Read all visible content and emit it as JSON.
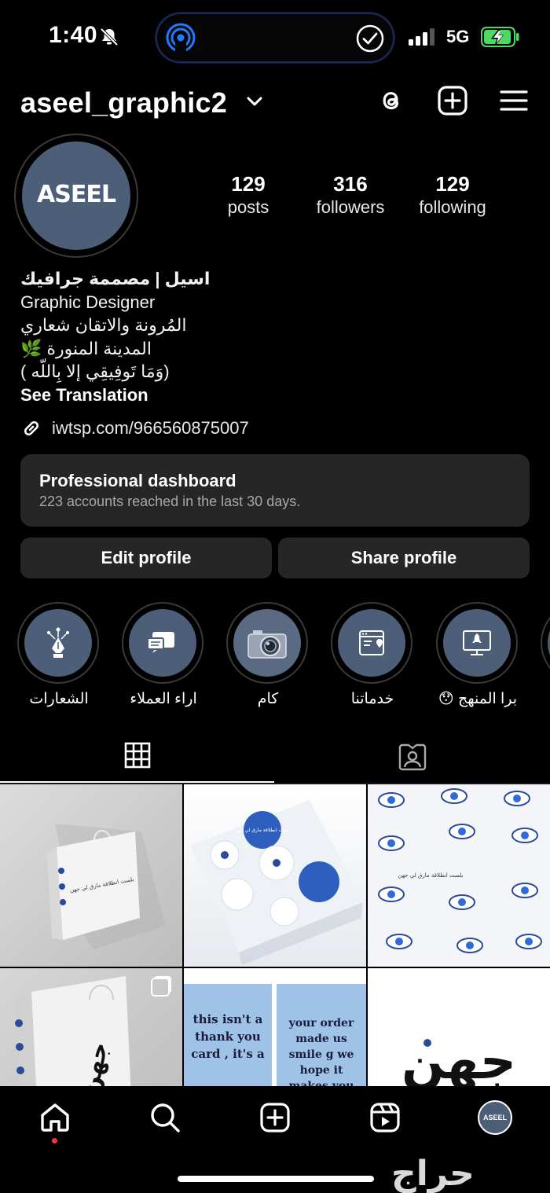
{
  "status_bar": {
    "time": "1:40",
    "network": "5G",
    "icons": [
      "bell-slash-icon",
      "airdrop-icon",
      "check-circle-icon",
      "signal-icon",
      "battery-charging-icon"
    ]
  },
  "header": {
    "username": "aseel_graphic2",
    "icons": [
      "threads-icon",
      "create-icon",
      "menu-icon"
    ]
  },
  "profile": {
    "avatar_text": "ASEEL",
    "stats": [
      {
        "value": "129",
        "label": "posts"
      },
      {
        "value": "316",
        "label": "followers"
      },
      {
        "value": "129",
        "label": "following"
      }
    ],
    "bio": {
      "name": "اسيل | مصممة جرافيك",
      "line1": "Graphic Designer",
      "line2": "المُرونة والاتقان شعاري",
      "line3": "المدينة المنورة 🌿",
      "line4": "(وَمَا تَوفِيقِي إلا بِاللّه )",
      "see_translation": "See Translation",
      "link": "iwtsp.com/966560875007"
    }
  },
  "dashboard": {
    "title": "Professional dashboard",
    "subtitle": "223 accounts reached in the last 30 days."
  },
  "buttons": {
    "edit": "Edit profile",
    "share": "Share profile"
  },
  "highlights": [
    {
      "label": "الشعارات",
      "icon": "pen-nib-icon"
    },
    {
      "label": "اراء العملاء",
      "icon": "chat-icon"
    },
    {
      "label": "كام",
      "icon": "camera-icon"
    },
    {
      "label": "خدماتنا",
      "icon": "services-icon"
    },
    {
      "label": "برا المنهج 😯",
      "icon": "rocket-screen-icon"
    },
    {
      "label": "...",
      "icon": "highlight-icon"
    }
  ],
  "tabs": [
    "grid-icon",
    "tagged-icon"
  ],
  "posts": {
    "p1_text": "بلست انطلاقة مارق لي جهن",
    "p2_text": "بلست انطلاقة مارق لي جهن",
    "p3_text": "بلست انطلاقة مارق لي جهن",
    "p5_left": "this isn't a thank you card , it's a",
    "p5_right": "your order made us smile g we hope it makes you smile too",
    "p6_text": "جهن",
    "p4_text": "جهن"
  },
  "nav": {
    "icons": [
      "home-icon",
      "search-icon",
      "create-icon",
      "reels-icon",
      "profile-avatar-icon"
    ],
    "watermark": "حراج"
  },
  "colors": {
    "background": "#000000",
    "card": "#262626",
    "avatar": "#4d5e78",
    "accent_blue": "#2f6bd8"
  }
}
